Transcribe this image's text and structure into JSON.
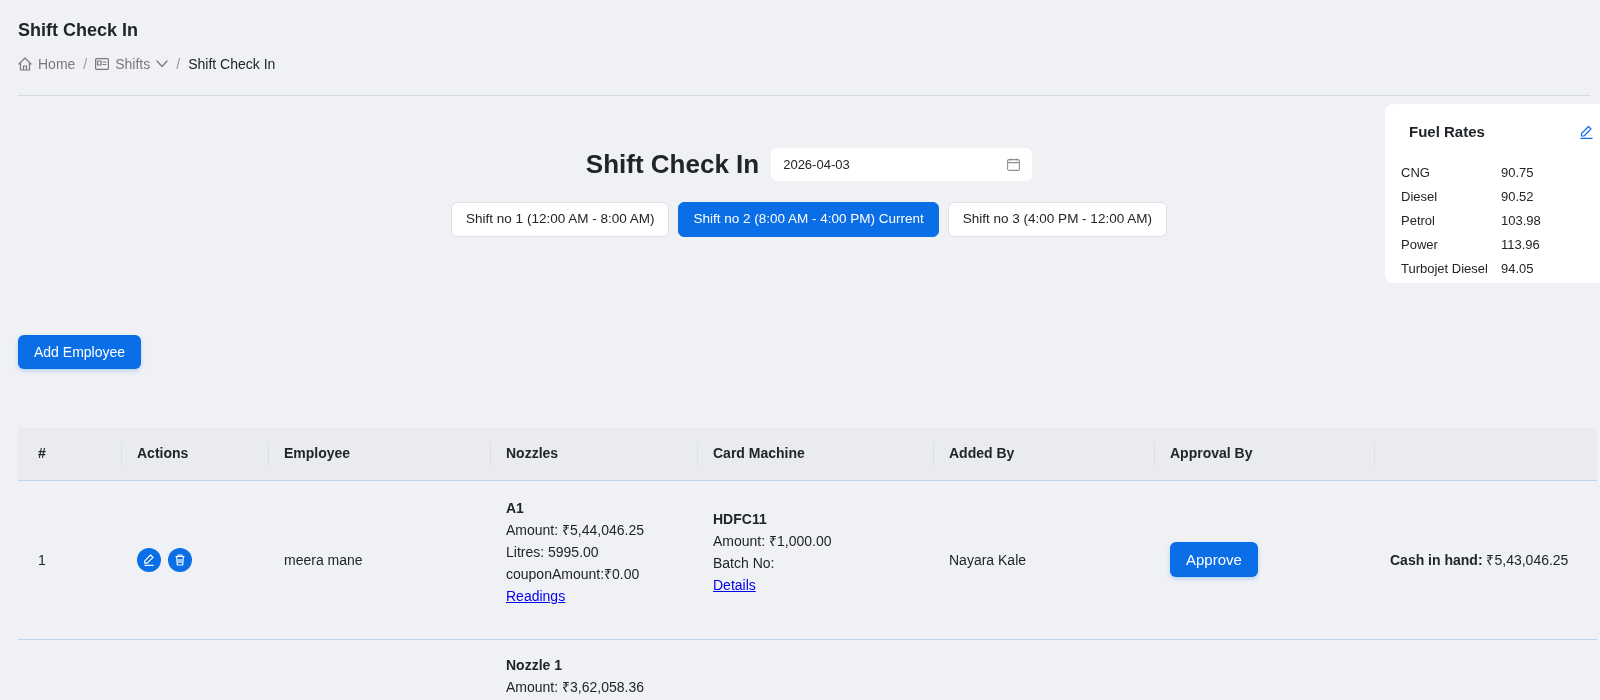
{
  "page_title": "Shift Check In",
  "breadcrumb": {
    "separator": "/",
    "items": [
      {
        "kind": "home",
        "label": "Home"
      },
      {
        "kind": "dropdown",
        "label": "Shifts"
      },
      {
        "kind": "current",
        "label": "Shift Check In"
      }
    ]
  },
  "shift_selector": {
    "heading": "Shift Check In",
    "date_field": {
      "value": "2026-04-03"
    },
    "shifts": [
      {
        "label": "Shift no 1 (12:00 AM - 8:00 AM)",
        "selected": false
      },
      {
        "label": "Shift no 2 (8:00 AM - 4:00 PM) Current",
        "selected": true
      },
      {
        "label": "Shift no 3 (4:00 PM - 12:00 AM)",
        "selected": false
      }
    ]
  },
  "fuel_rates": {
    "title": "Fuel Rates",
    "rates": [
      {
        "fuel": "CNG",
        "rate": "90.75"
      },
      {
        "fuel": "Diesel",
        "rate": "90.52"
      },
      {
        "fuel": "Petrol",
        "rate": "103.98"
      },
      {
        "fuel": "Power",
        "rate": "113.96"
      },
      {
        "fuel": "Turbojet Diesel",
        "rate": "94.05"
      }
    ]
  },
  "add_button": "Add Employee",
  "table": {
    "columns": [
      "#",
      "Actions",
      "Employee",
      "Nozzles",
      "Card Machine",
      "Added By",
      "Approval By"
    ],
    "rows": [
      {
        "number": "1",
        "actions": [
          {
            "kind": "edit"
          },
          {
            "kind": "delete"
          }
        ],
        "employee": "meera mane",
        "nozzles": [
          {
            "name": "A1",
            "lines": [
              "Amount: ₹5,44,046.25",
              "Litres: 5995.00",
              "couponAmount:₹0.00"
            ],
            "link": "Readings"
          }
        ],
        "card_machines": [
          {
            "name": "HDFC11",
            "lines": [
              "Amount: ₹1,000.00",
              "Batch No:"
            ],
            "link": "Details"
          }
        ],
        "added_by": "Nayara Kale",
        "approve_button": "Approve",
        "cash_in_hand": "**Cash in hand:** ₹5,43,046.25"
      },
      {
        "nozzles": [
          {
            "name": "Nozzle 1",
            "lines": [
              "Amount: ₹3,62,058.36"
            ]
          }
        ]
      }
    ]
  }
}
